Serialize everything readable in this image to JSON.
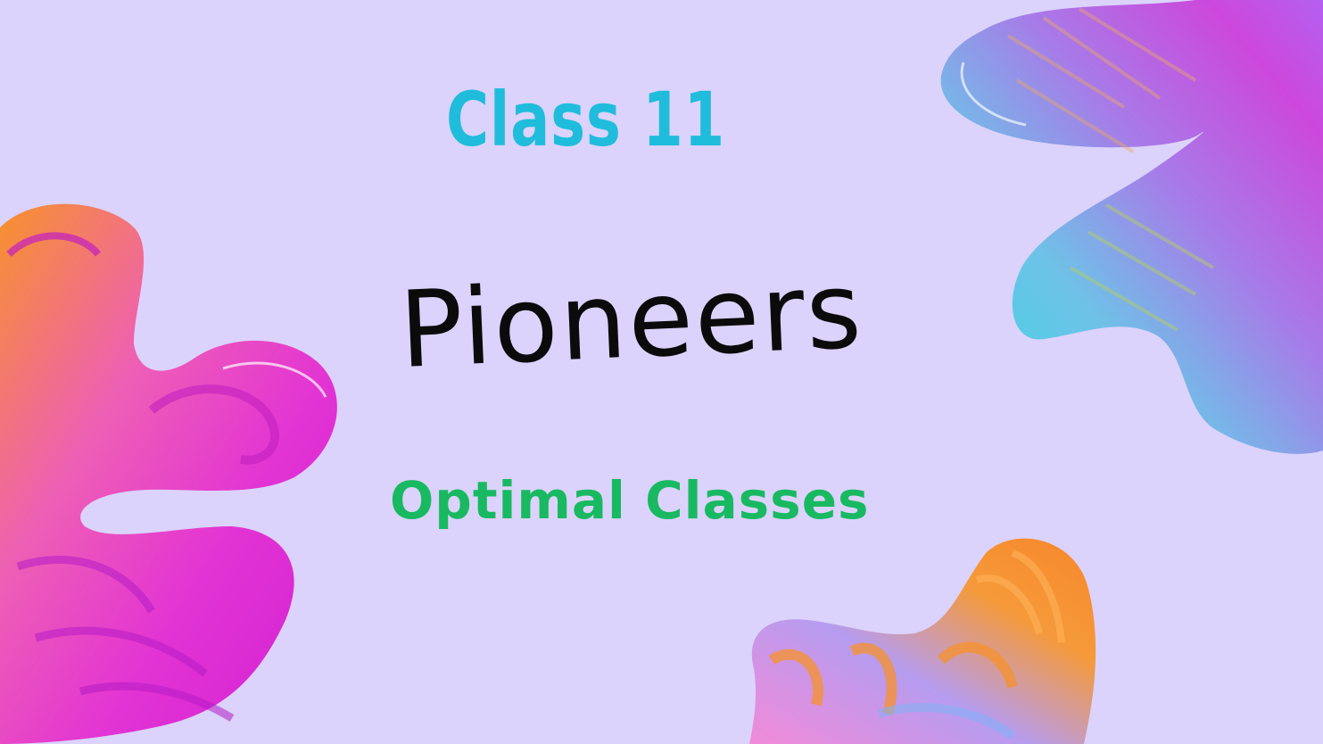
{
  "slide": {
    "title": "Class 11",
    "headline": "Pioneers",
    "subtitle": "Optimal Classes"
  },
  "colors": {
    "background": "#dbd3fb",
    "title": "#1fbcdc",
    "headline": "#0b0b0b",
    "subtitle": "#18b961",
    "accent_magenta": "#e632c8",
    "accent_orange": "#f7922b",
    "accent_cyan": "#38d6e6",
    "accent_violet": "#b462f0"
  },
  "decorations": [
    "paint-blob-magenta-orange",
    "paint-blob-cyan-violet",
    "paint-blob-orange-lavender"
  ]
}
